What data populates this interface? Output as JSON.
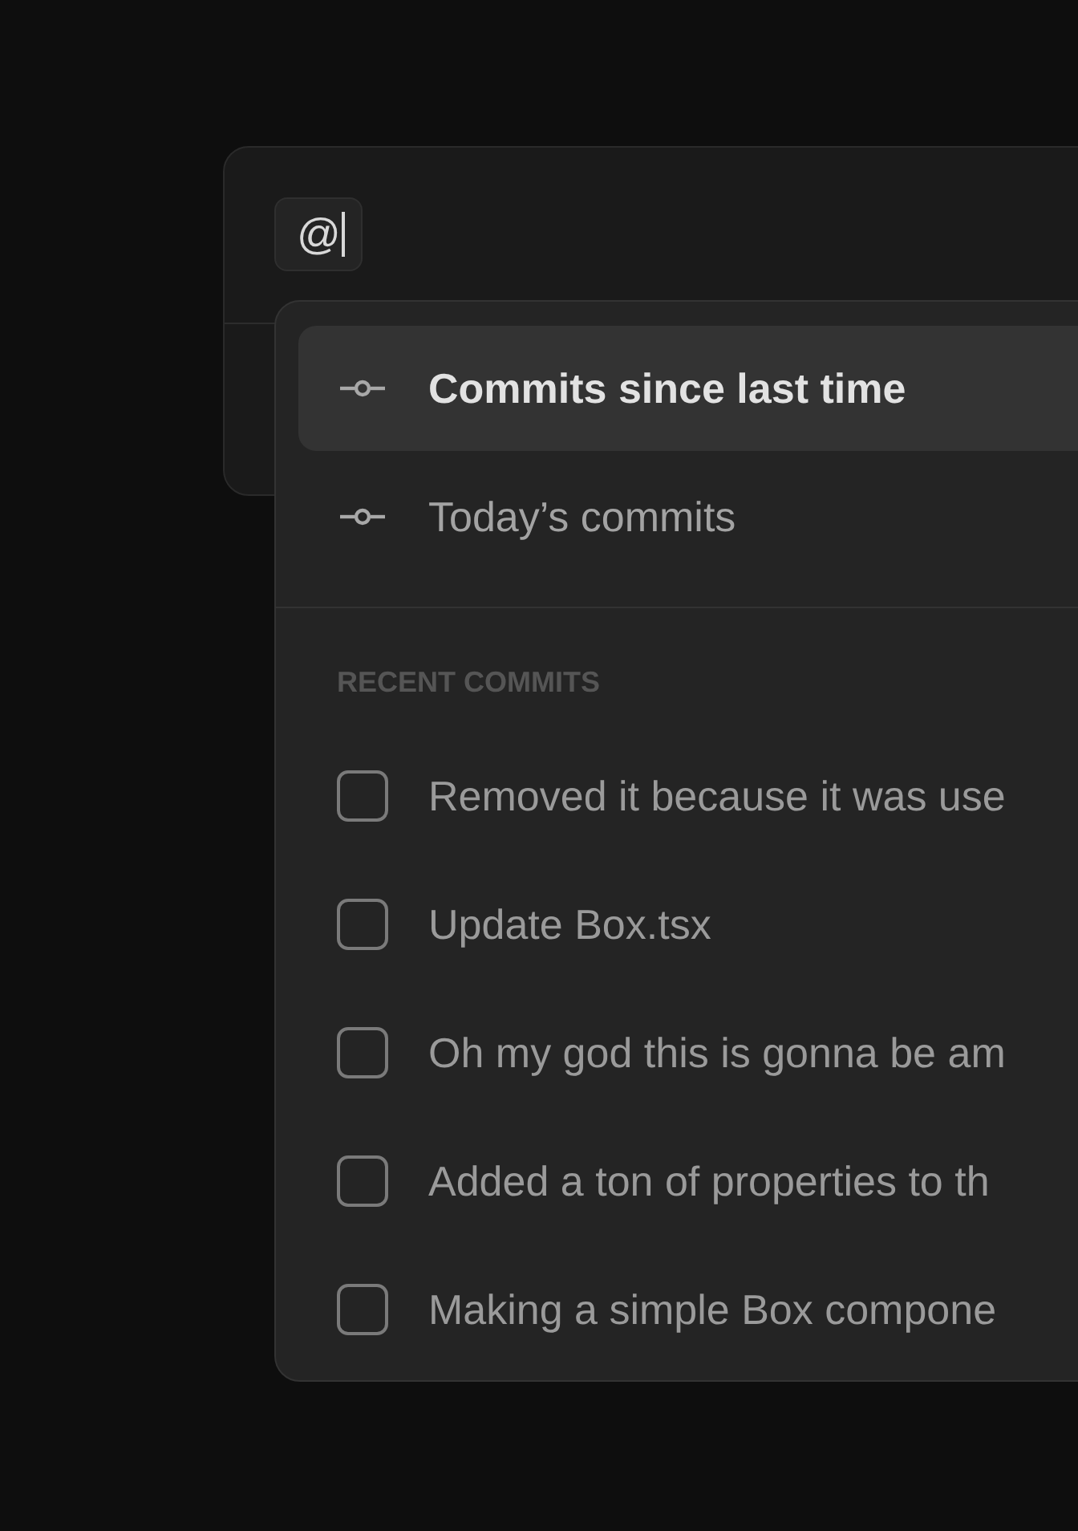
{
  "editor": {
    "mention": "@"
  },
  "menu": {
    "items": [
      {
        "label": "Commits since last time",
        "selected": true
      },
      {
        "label": "Today’s commits",
        "selected": false
      }
    ],
    "recent": {
      "heading": "RECENT COMMITS",
      "commits": [
        {
          "message": "Removed it because it was use",
          "checked": false
        },
        {
          "message": "Update Box.tsx",
          "checked": false
        },
        {
          "message": "Oh my god this is gonna be am",
          "checked": false
        },
        {
          "message": "Added a ton of properties to th",
          "checked": false
        },
        {
          "message": "Making a simple Box compone",
          "checked": false
        }
      ]
    }
  }
}
